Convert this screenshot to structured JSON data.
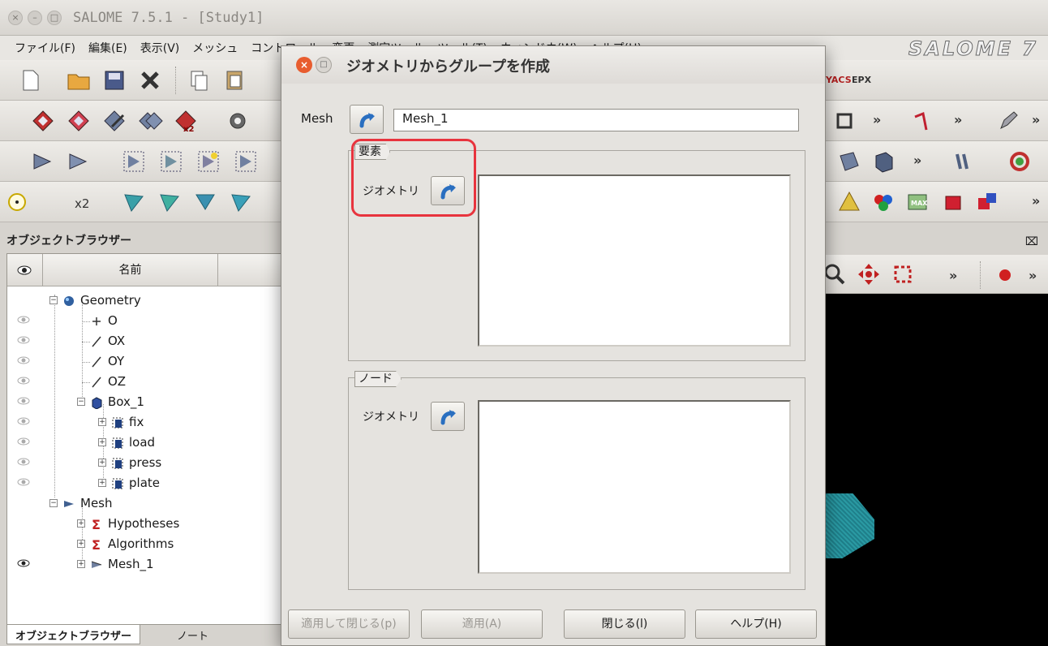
{
  "window": {
    "title": "SALOME 7.5.1 - [Study1]",
    "close_glyph": "×",
    "minimize_glyph": "–",
    "maximize_glyph": "□",
    "logo": "SALOME 7"
  },
  "menu": {
    "items": [
      "ファイル(F)",
      "編集(E)",
      "表示(V)",
      "メッシュ",
      "コントロール",
      "変更",
      "測定ツール",
      "ツール(T)",
      "ウィンドウ(W)",
      "ヘルプ(H)"
    ]
  },
  "toolbar": {
    "labels": {
      "ycas": "YACS",
      "epx": "EPX",
      "x2": "x2",
      "more": "»"
    }
  },
  "object_browser": {
    "title": "オブジェクトブラウザー",
    "column_name": "名前",
    "tabs": [
      "オブジェクトブラウザー",
      "ノート"
    ],
    "tree": [
      {
        "label": "Geometry",
        "level": 0,
        "icon": "geometry-icon",
        "expander": "−",
        "eye": false
      },
      {
        "label": "O",
        "level": 1,
        "icon": "point-icon",
        "eye": true
      },
      {
        "label": "OX",
        "level": 1,
        "icon": "vector-icon",
        "eye": true
      },
      {
        "label": "OY",
        "level": 1,
        "icon": "vector-icon",
        "eye": true
      },
      {
        "label": "OZ",
        "level": 1,
        "icon": "vector-icon",
        "eye": true
      },
      {
        "label": "Box_1",
        "level": 1,
        "icon": "box-icon",
        "expander": "−",
        "eye": true
      },
      {
        "label": "fix",
        "level": 2,
        "icon": "group-icon",
        "expander": "+",
        "eye": true
      },
      {
        "label": "load",
        "level": 2,
        "icon": "group-icon",
        "expander": "+",
        "eye": true
      },
      {
        "label": "press",
        "level": 2,
        "icon": "group-icon",
        "expander": "+",
        "eye": true
      },
      {
        "label": "plate",
        "level": 2,
        "icon": "group-icon",
        "expander": "+",
        "eye": true
      },
      {
        "label": "Mesh",
        "level": 0,
        "icon": "mesh-module-icon",
        "expander": "−",
        "eye": false
      },
      {
        "label": "Hypotheses",
        "level": 1,
        "icon": "sigma-icon",
        "expander": "+",
        "eye": false
      },
      {
        "label": "Algorithms",
        "level": 1,
        "icon": "sigma-icon",
        "expander": "+",
        "eye": false
      },
      {
        "label": "Mesh_1",
        "level": 1,
        "icon": "mesh-icon",
        "expander": "+",
        "eye": true
      }
    ]
  },
  "viewer": {
    "close_glyph": "⌧",
    "more": "»"
  },
  "dialog": {
    "title": "ジオメトリからグループを作成",
    "close_glyph": "×",
    "max_glyph": "□",
    "mesh_label": "Mesh",
    "mesh_value": "Mesh_1",
    "elements_group": "要素",
    "nodes_group": "ノード",
    "geometry_label": "ジオメトリ",
    "buttons": {
      "apply_close": "適用して閉じる(p)",
      "apply": "適用(A)",
      "close": "閉じる(l)",
      "help": "ヘルプ(H)"
    }
  },
  "colors": {
    "highlight": "#e8343e",
    "dialog_close": "#e85d2f",
    "viewer_bg": "#000000"
  }
}
